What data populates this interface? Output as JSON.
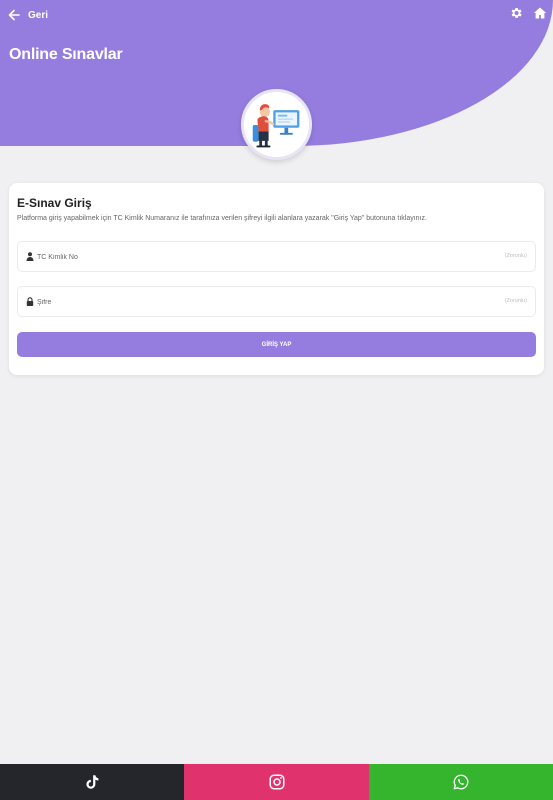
{
  "topbar": {
    "back_label": "Geri",
    "back_icon": "arrow-left-icon",
    "settings_icon": "gear-icon",
    "home_icon": "home-icon"
  },
  "header": {
    "title": "Online Sınavlar",
    "bg_color": "#957de0",
    "illustration": "computer-user-illustration"
  },
  "card": {
    "title": "E-Sınav Giriş",
    "description": "Platforma giriş yapabilmek için TC Kimlik Numaranız ile tarafınıza verilen şifreyi ilgili alanlara yazarak \"Giriş Yap\" butonuna tıklayınız.",
    "fields": [
      {
        "icon": "user-icon",
        "placeholder": "TC Kimlik No",
        "required_label": "(Zorunlu)"
      },
      {
        "icon": "lock-icon",
        "placeholder": "Şifre",
        "required_label": "(Zorunlu)"
      }
    ],
    "submit_label": "GİRİŞ YAP"
  },
  "footer": {
    "items": [
      {
        "icon": "tiktok-icon",
        "color": "#24262c"
      },
      {
        "icon": "instagram-icon",
        "color": "#e0326d"
      },
      {
        "icon": "whatsapp-icon",
        "color": "#35b42e"
      }
    ]
  }
}
